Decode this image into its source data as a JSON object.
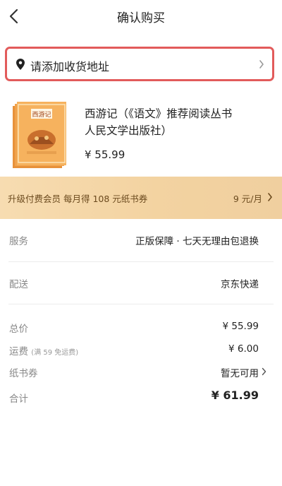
{
  "header": {
    "title": "确认购买"
  },
  "address": {
    "label": "请添加收货地址"
  },
  "product": {
    "title_line1": "西游记（《语文》推荐阅读丛书",
    "title_line2": "人民文学出版社）",
    "price": "¥ 55.99"
  },
  "vip": {
    "text": "升级付费会员 每月得 108 元纸书券",
    "price": "9 元/月"
  },
  "service": {
    "label": "服务",
    "value": "正版保障 · 七天无理由包退换"
  },
  "delivery": {
    "label": "配送",
    "value": "京东快递"
  },
  "summary": {
    "total_label": "总价",
    "total_value": "¥ 55.99",
    "shipping_label": "运费",
    "shipping_note": "(满 59 免运费)",
    "shipping_value": "¥ 6.00",
    "coupon_label": "纸书券",
    "coupon_value": "暂无可用",
    "sum_label": "合计",
    "sum_value": "¥ 61.99"
  },
  "colors": {
    "highlight_border": "#e25b5b",
    "vip_bg": "#f3d3a1",
    "vip_text": "#6b4a1e"
  }
}
